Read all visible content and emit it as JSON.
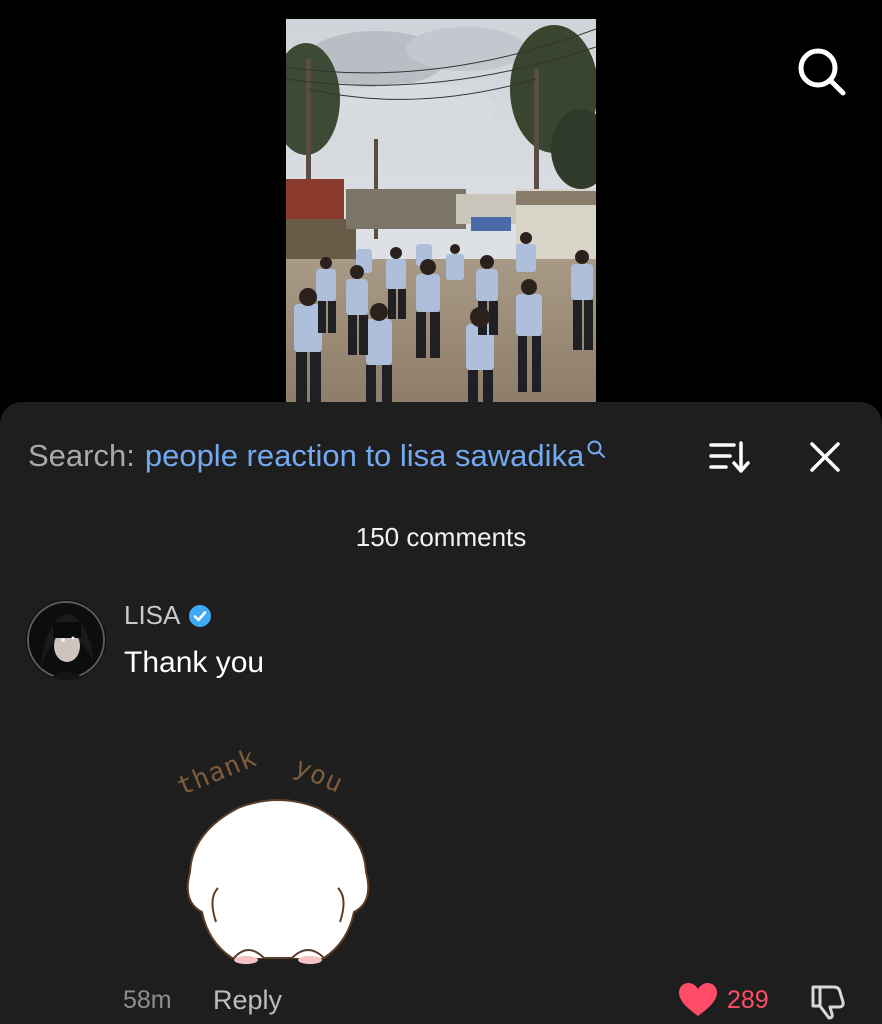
{
  "video": {
    "thumbnail_icon": "video-thumbnail-dancing-students-street"
  },
  "top_bar": {
    "search_icon": "search-icon"
  },
  "comments_sheet": {
    "search_prefix": "Search:",
    "search_query": "people reaction to lisa sawadika",
    "sort_icon": "sort-icon",
    "close_icon": "close-icon",
    "comments_count": "150 comments"
  },
  "comment": {
    "author": "LISA",
    "verified": true,
    "text": "Thank you",
    "sticker_text_1": "thank",
    "sticker_text_2": "you",
    "timestamp": "58m",
    "reply_label": "Reply",
    "likes": "289",
    "liked": true
  },
  "colors": {
    "sheet_background": "#1e1e1e",
    "search_query": "#74a9f0",
    "like": "#ff4d67",
    "verified": "#3fa9f5"
  }
}
